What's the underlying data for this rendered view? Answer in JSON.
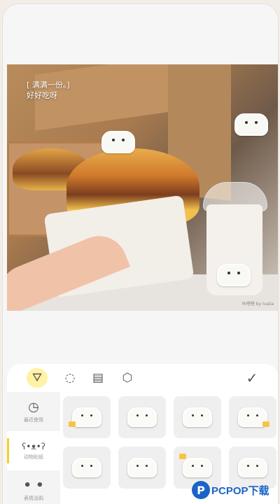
{
  "photo": {
    "caption_line1": "[ 满满一份。]",
    "caption_line2": "好好吃呀",
    "watermark": "咔嗒嗒 by Ivalia"
  },
  "toolbar": {
    "tools": [
      {
        "name": "sticker-tool-icon",
        "glyph": "⛛"
      },
      {
        "name": "shape-tool-icon",
        "glyph": "◌"
      },
      {
        "name": "shop-tool-icon",
        "glyph": "▤"
      },
      {
        "name": "settings-tool-icon",
        "glyph": "⬡"
      }
    ],
    "confirm_glyph": "✓"
  },
  "sidebar": {
    "items": [
      {
        "label": "最近使用",
        "icon": "◷"
      },
      {
        "label": "动物贴纸",
        "icon": "ʕ•ᴥ•ʔ"
      },
      {
        "label": "表情涂鸦",
        "icon": "• •"
      }
    ]
  },
  "logo": {
    "mark": "P",
    "text": "PCPOP下载"
  },
  "colors": {
    "accent": "#f6cf2a",
    "brand": "#1b63c6"
  }
}
